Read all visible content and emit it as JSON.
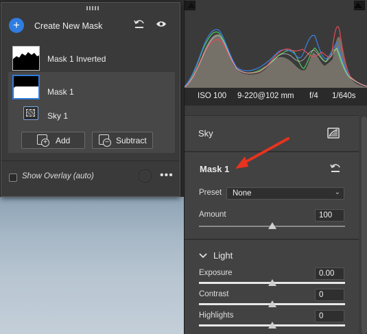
{
  "masks_panel": {
    "create_label": "Create New Mask",
    "masks": [
      {
        "label": "Mask 1 Inverted"
      },
      {
        "label": "Mask 1"
      }
    ],
    "component": {
      "label": "Sky 1"
    },
    "add_label": "Add",
    "subtract_label": "Subtract",
    "show_overlay_label": "Show Overlay (auto)",
    "accent_color": "#2f7de0"
  },
  "histogram": {
    "channels": [
      "red",
      "green",
      "blue",
      "luminance"
    ],
    "exif": {
      "iso": "ISO 100",
      "lens": "9-220@102 mm",
      "aperture": "f/4",
      "shutter": "1/640s"
    }
  },
  "mask_settings": {
    "type_label": "Sky",
    "mask_name": "Mask 1",
    "preset_label": "Preset",
    "preset_value": "None",
    "amount_label": "Amount",
    "amount_value": "100",
    "amount_level": 0.5
  },
  "light_section": {
    "title": "Light",
    "rows": [
      {
        "label": "Exposure",
        "value": "0.00",
        "level": 0.5
      },
      {
        "label": "Contrast",
        "value": "0",
        "level": 0.5
      },
      {
        "label": "Highlights",
        "value": "0",
        "level": 0.5
      }
    ]
  },
  "annotation": {
    "arrow_color": "#e8321e"
  }
}
